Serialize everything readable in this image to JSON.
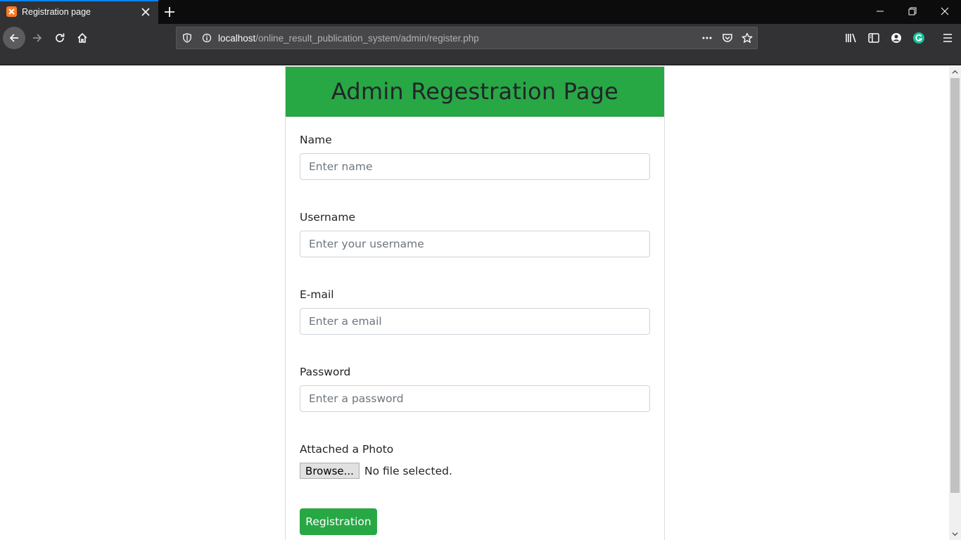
{
  "browser": {
    "tab_title": "Registration page",
    "url_host": "localhost",
    "url_path": "/online_result_publication_system/admin/register.php",
    "accent_color": "#0a84ff"
  },
  "form": {
    "title": "Admin Regestration Page",
    "header_color": "#28a745",
    "fields": [
      {
        "label": "Name",
        "placeholder": "Enter name"
      },
      {
        "label": "Username",
        "placeholder": "Enter your username"
      },
      {
        "label": "E-mail",
        "placeholder": "Enter a email"
      },
      {
        "label": "Password",
        "placeholder": "Enter a password"
      }
    ],
    "photo_label": "Attached a Photo",
    "browse_label": "Browse...",
    "file_status": "No file selected.",
    "submit_label": "Registration"
  }
}
